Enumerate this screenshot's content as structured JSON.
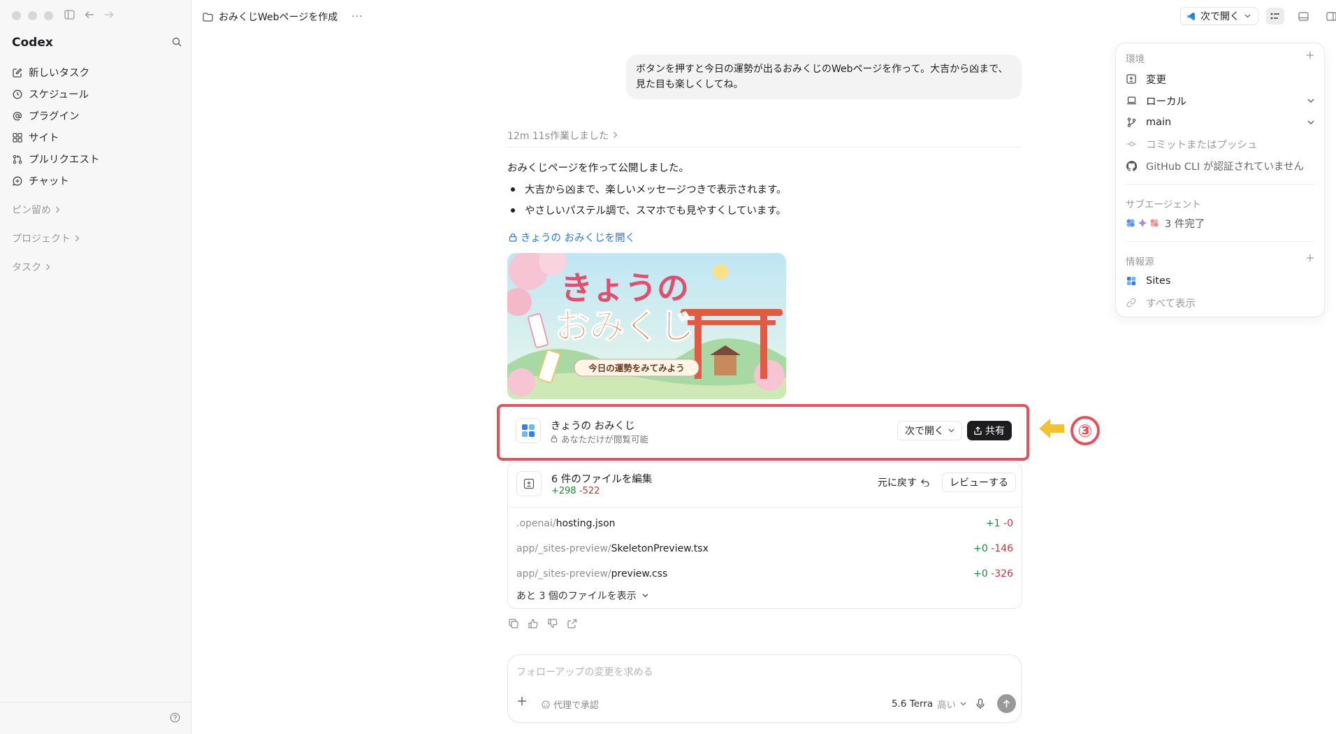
{
  "window": {
    "traffic": [
      "close",
      "minimize",
      "zoom"
    ]
  },
  "sidebar": {
    "brand": "Codex",
    "items": [
      {
        "label": "新しいタスク",
        "icon": "edit-icon"
      },
      {
        "label": "スケジュール",
        "icon": "clock-icon"
      },
      {
        "label": "プラグイン",
        "icon": "at-icon"
      },
      {
        "label": "サイト",
        "icon": "grid-icon"
      },
      {
        "label": "プルリクエスト",
        "icon": "pull-request-icon"
      },
      {
        "label": "チャット",
        "icon": "chat-icon"
      }
    ],
    "sections": {
      "pinned": "ピン留め",
      "projects": "プロジェクト",
      "tasks": "タスク"
    }
  },
  "topbar": {
    "title": "おみくじWebページを作成",
    "more": "···",
    "open_with": "次で開く"
  },
  "chat": {
    "user_message": "ボタンを押すと今日の運勢が出るおみくじのWebページを作って。大吉から凶まで、見た目も楽しくしてね。",
    "worked": "12m 11s作業しました",
    "reply": "おみくじページを作って公開しました。",
    "bullets": [
      "大吉から凶まで、楽しいメッセージつきで表示されます。",
      "やさしいパステル調で、スマホでも見やすくしています。"
    ],
    "link": "きょうの おみくじを開く"
  },
  "banner": {
    "title_line1": "きょうの",
    "title_line2": "おみくじ",
    "subtitle": "今日の運勢をみてみよう"
  },
  "site_card": {
    "title": "きょうの おみくじ",
    "visibility": "あなただけが閲覧可能",
    "open_with": "次で開く",
    "share": "共有"
  },
  "annotation": {
    "step": "③",
    "highlight_color": "#e3525b",
    "arrow_color": "#f2c230"
  },
  "files": {
    "title": "6 件のファイルを編集",
    "added": "+298",
    "removed": "-522",
    "revert": "元に戻す",
    "review": "レビューする",
    "rows": [
      {
        "dir": ".openai/",
        "name": "hosting.json",
        "add": "+1",
        "del": "-0"
      },
      {
        "dir": "app/_sites-preview/",
        "name": "SkeletonPreview.tsx",
        "add": "+0",
        "del": "-146"
      },
      {
        "dir": "app/_sites-preview/",
        "name": "preview.css",
        "add": "+0",
        "del": "-326"
      }
    ],
    "more": "あと 3 個のファイルを表示"
  },
  "composer": {
    "placeholder": "フォローアップの変更を求める",
    "approve": "代理で承認",
    "model": "5.6 Terra",
    "effort": "高い"
  },
  "panel": {
    "env_header": "環境",
    "rows": [
      {
        "label": "変更",
        "icon": "diff-icon"
      },
      {
        "label": "ローカル",
        "icon": "laptop-icon"
      },
      {
        "label": "main",
        "icon": "branch-icon"
      },
      {
        "label": "コミットまたはプッシュ",
        "icon": "commit-icon"
      },
      {
        "label": "GitHub CLI が認証されていません",
        "icon": "github-icon"
      }
    ],
    "sub_header": "サブエージェント",
    "sub_status": "3 件完了",
    "src_header": "情報源",
    "src_sites": "Sites",
    "src_all": "すべて表示"
  }
}
